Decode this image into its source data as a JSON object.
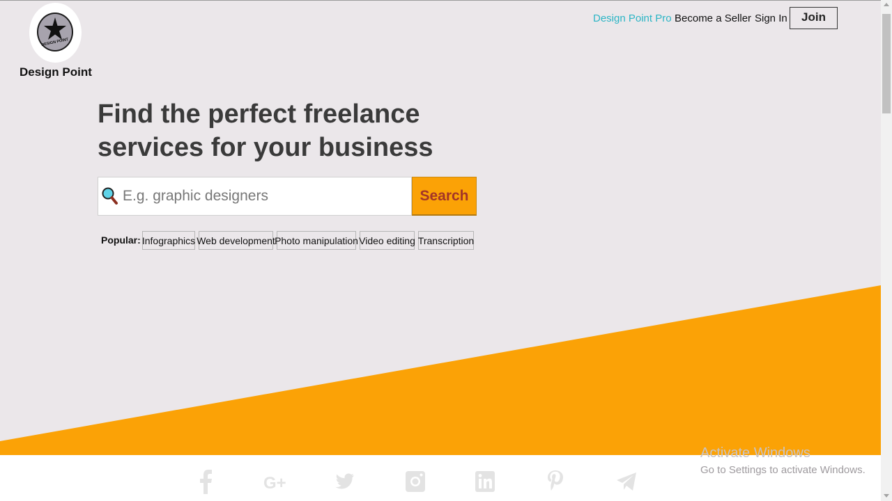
{
  "brand": {
    "name": "Design Point",
    "badge_text": "DESIGN POINT"
  },
  "nav": {
    "pro": "Design Point Pro",
    "seller": "Become a Seller",
    "signin": "Sign In",
    "join": "Join"
  },
  "hero": {
    "headline_line1": "Find the perfect freelance",
    "headline_line2": "services for your business",
    "search_placeholder": "E.g. graphic designers",
    "search_value": "",
    "search_button": "Search",
    "popular_label": "Popular:",
    "popular_tags": [
      "Infographics",
      "Web development",
      "Photo manipulation",
      "Video editing",
      "Transcription"
    ]
  },
  "social_icons": [
    "facebook-icon",
    "google-plus-icon",
    "twitter-icon",
    "instagram-icon",
    "linkedin-icon",
    "pinterest-icon",
    "telegram-icon"
  ],
  "watermark": {
    "title": "Activate Windows",
    "subtitle": "Go to Settings to activate Windows."
  },
  "colors": {
    "background": "#ebe7ea",
    "accent_orange": "#fba206",
    "search_text": "#a33528",
    "pro_link": "#2bb5c5",
    "headline": "#3a3a3a"
  }
}
